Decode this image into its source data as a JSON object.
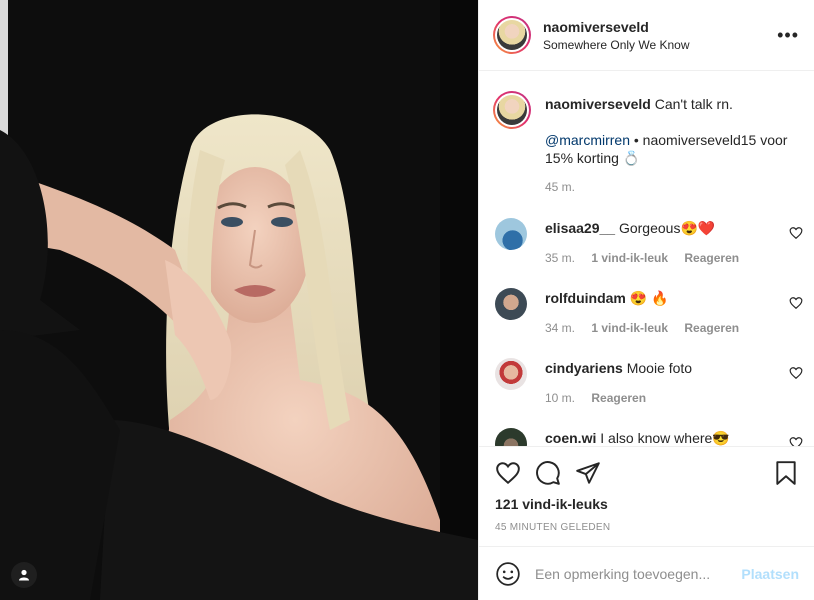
{
  "post": {
    "username": "naomiverseveld",
    "location": "Somewhere Only We Know",
    "more_glyph": "•••"
  },
  "caption": {
    "username": "naomiverseveld",
    "text": "Can't talk rn.",
    "mention": "@marcmirren",
    "body": "• naomiverseveld15 voor 15% korting 💍",
    "time": "45 m."
  },
  "comments": [
    {
      "user": "elisaa29__",
      "text": "Gorgeous😍❤️",
      "time": "35 m.",
      "likes": "1 vind-ik-leuk",
      "reply": "Reageren"
    },
    {
      "user": "rolfduindam",
      "text": "😍 🔥",
      "time": "34 m.",
      "likes": "1 vind-ik-leuk",
      "reply": "Reageren"
    },
    {
      "user": "cindyariens",
      "text": "Mooie foto",
      "time": "10 m.",
      "likes": "",
      "reply": "Reageren"
    },
    {
      "user": "coen.wi",
      "text": "I also know where😎",
      "time": "",
      "likes": "",
      "reply": ""
    }
  ],
  "actions": {
    "likes_count": "121 vind-ik-leuks",
    "posted_ago": "45 MINUTEN GELEDEN"
  },
  "composer": {
    "placeholder": "Een opmerking toevoegen...",
    "post_label": "Plaatsen"
  },
  "colors": {
    "link": "#00376b",
    "muted": "#8e8e8e",
    "post_disabled": "#b2dffc",
    "story_ring": "#e1306c"
  },
  "icons": [
    "user-tag-icon",
    "more-options-icon",
    "heart-icon",
    "comment-icon",
    "share-icon",
    "bookmark-icon",
    "emoji-icon"
  ]
}
